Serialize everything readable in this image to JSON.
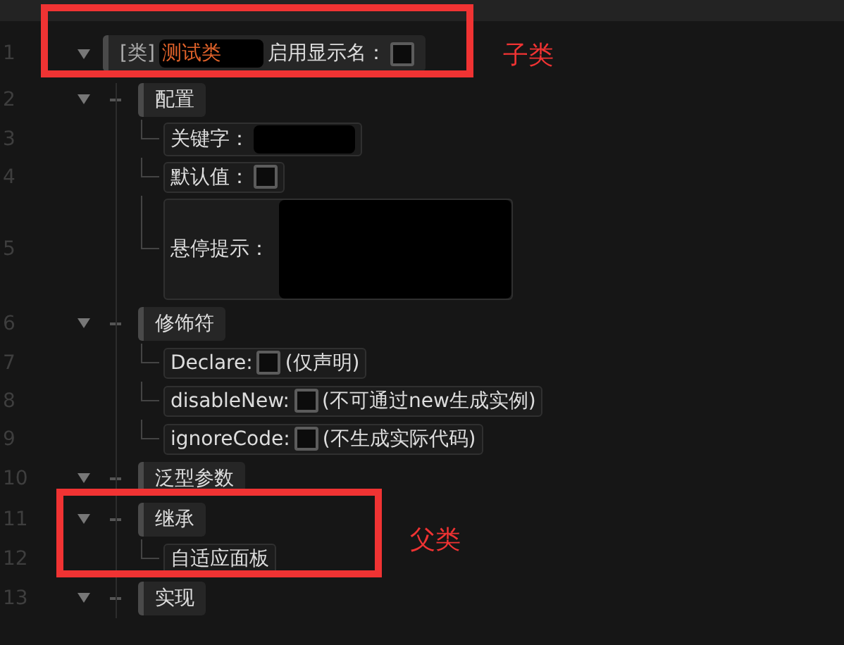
{
  "tree": {
    "line": "1",
    "kind": "class",
    "expanded": true,
    "tag": "[类]",
    "name": "测试类",
    "label": "启用显示名：",
    "checked": false,
    "children": [
      {
        "line": "2",
        "kind": "group",
        "expanded": true,
        "label": "配置",
        "children": [
          {
            "line": "3",
            "kind": "text_field",
            "label": "关键字："
          },
          {
            "line": "4",
            "kind": "checkbox",
            "label": "默认值：",
            "checked": false
          },
          {
            "line": "5",
            "kind": "textarea",
            "label": "悬停提示："
          }
        ]
      },
      {
        "line": "6",
        "kind": "group",
        "expanded": true,
        "label": "修饰符",
        "children": [
          {
            "line": "7",
            "kind": "checkbox",
            "label": "Declare:",
            "checked": false,
            "note": "(仅声明)"
          },
          {
            "line": "8",
            "kind": "checkbox",
            "label": "disableNew:",
            "checked": false,
            "note": "(不可通过new生成实例)"
          },
          {
            "line": "9",
            "kind": "checkbox",
            "label": "ignoreCode:",
            "checked": false,
            "note": "(不生成实际代码)"
          }
        ]
      },
      {
        "line": "10",
        "kind": "group",
        "expanded": true,
        "label": "泛型参数"
      },
      {
        "line": "11",
        "kind": "group",
        "expanded": true,
        "label": "继承",
        "children": [
          {
            "line": "12",
            "kind": "text",
            "label": "自适应面板"
          }
        ]
      },
      {
        "line": "13",
        "kind": "group",
        "expanded": true,
        "label": "实现"
      }
    ]
  },
  "annotations": [
    {
      "label": "子类"
    },
    {
      "label": "父类"
    }
  ]
}
